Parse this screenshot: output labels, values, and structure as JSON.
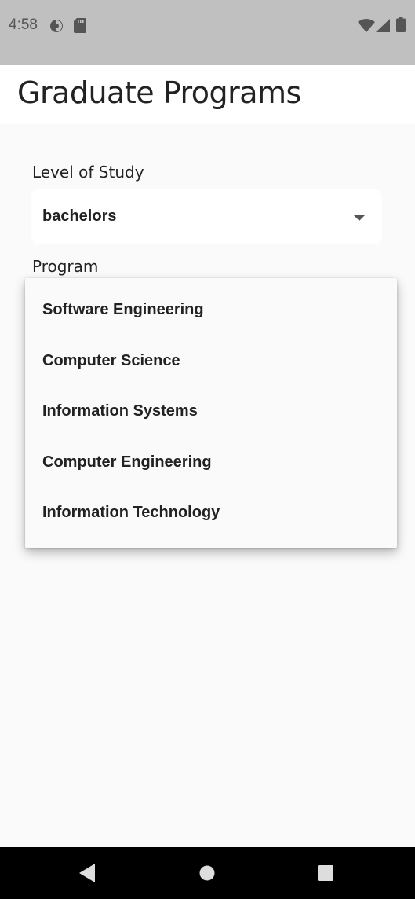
{
  "status_bar": {
    "time": "4:58",
    "icons": [
      "data-saver-icon",
      "sd-card-icon",
      "wifi-icon",
      "signal-icon",
      "battery-icon"
    ]
  },
  "app_bar": {
    "title": "Graduate Programs"
  },
  "form": {
    "level_label": "Level of Study",
    "level_value": "bachelors",
    "program_label": "Program"
  },
  "program_menu": {
    "items": [
      "Software Engineering",
      "Computer Science",
      "Information Systems",
      "Computer Engineering",
      "Information Technology"
    ]
  },
  "nav_bar": {
    "icons": [
      "back-icon",
      "home-icon",
      "recents-icon"
    ]
  },
  "colors": {
    "status_bar": "#c0c0c0",
    "app_bar": "#ffffff",
    "background": "#fafafa",
    "text": "#222222",
    "nav_bar": "#000000"
  }
}
